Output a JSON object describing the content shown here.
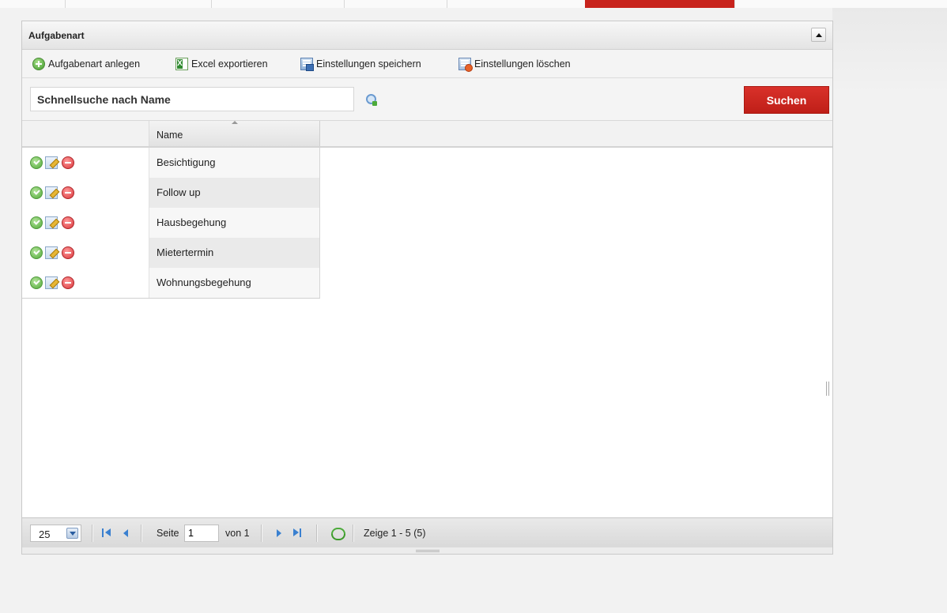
{
  "panel": {
    "title": "Aufgabenart"
  },
  "toolbar": {
    "add_label": "Aufgabenart anlegen",
    "export_label": "Excel exportieren",
    "save_settings_label": "Einstellungen speichern",
    "delete_settings_label": "Einstellungen löschen"
  },
  "search": {
    "placeholder": "Schnellsuche nach Name",
    "button_label": "Suchen"
  },
  "grid": {
    "columns": [
      "",
      "Name"
    ],
    "sorted_column": "Name",
    "rows": [
      {
        "name": "Besichtigung"
      },
      {
        "name": "Follow up"
      },
      {
        "name": "Hausbegehung"
      },
      {
        "name": "Mietertermin"
      },
      {
        "name": "Wohnungsbegehung"
      }
    ],
    "row_actions": [
      "check-icon",
      "edit-icon",
      "delete-icon"
    ]
  },
  "pager": {
    "page_size": "25",
    "page_label": "Seite",
    "current_page": "1",
    "of_label": "von 1",
    "display_info": "Zeige 1 - 5 (5)"
  },
  "colors": {
    "accent": "#c8231c",
    "search_button": "#c9271f",
    "icon_blue": "#3a80d0",
    "icon_green": "#4ea836"
  }
}
